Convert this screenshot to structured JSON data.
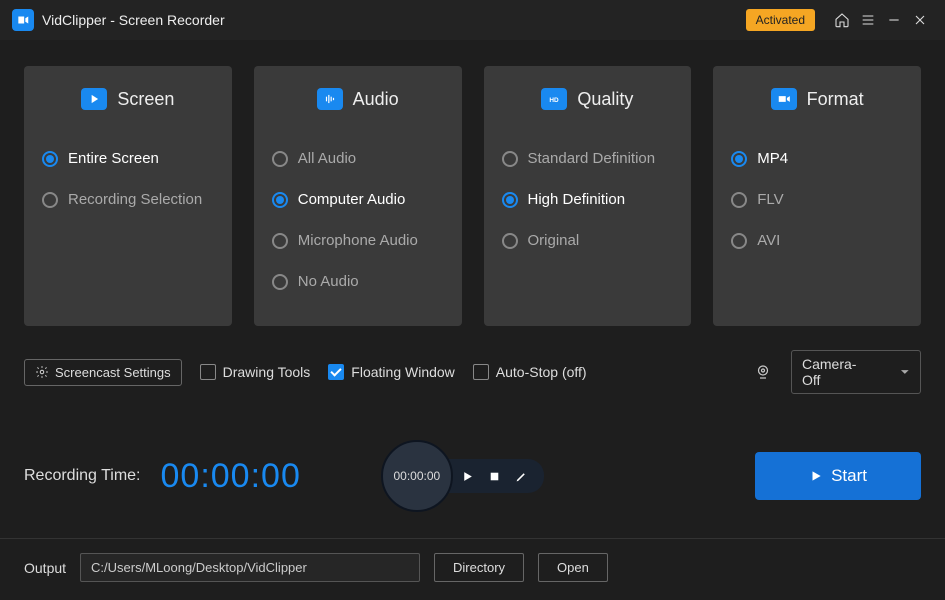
{
  "title_bar": {
    "app_title": "VidClipper - Screen Recorder",
    "activated_label": "Activated"
  },
  "cards": {
    "screen": {
      "title": "Screen",
      "opt_entire": "Entire Screen",
      "opt_selection": "Recording Selection"
    },
    "audio": {
      "title": "Audio",
      "opt_all": "All Audio",
      "opt_computer": "Computer Audio",
      "opt_mic": "Microphone Audio",
      "opt_none": "No Audio"
    },
    "quality": {
      "title": "Quality",
      "opt_sd": "Standard Definition",
      "opt_hd": "High Definition",
      "opt_orig": "Original"
    },
    "format": {
      "title": "Format",
      "opt_mp4": "MP4",
      "opt_flv": "FLV",
      "opt_avi": "AVI"
    }
  },
  "options": {
    "screencast_settings": "Screencast Settings",
    "drawing_tools": "Drawing Tools",
    "floating_window": "Floating Window",
    "auto_stop": "Auto-Stop  (off)",
    "camera_select": "Camera-Off"
  },
  "recording": {
    "label": "Recording Time:",
    "timer": "00:00:00",
    "small_timer": "00:00:00",
    "start_label": "Start"
  },
  "output": {
    "label": "Output",
    "path": "C:/Users/MLoong/Desktop/VidClipper",
    "directory_btn": "Directory",
    "open_btn": "Open"
  }
}
